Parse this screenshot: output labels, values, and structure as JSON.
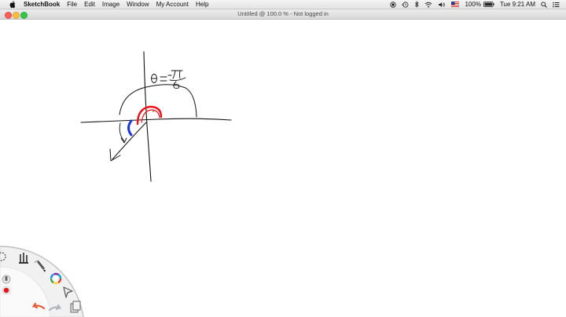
{
  "menubar": {
    "app_name": "SketchBook",
    "items": [
      "File",
      "Edit",
      "Image",
      "Window",
      "My Account",
      "Help"
    ],
    "battery": "100%",
    "clock": "Tue 9:21 AM"
  },
  "window": {
    "title": "Untitled @ 100.0 % - Not logged in"
  },
  "sketch": {
    "theta_label": "θ = -π/6",
    "colors": {
      "ink": "#111111",
      "arc_red": "#e8141b",
      "arc_blue": "#1b35d8"
    }
  },
  "toolbar": {
    "tools": [
      "settings-icon",
      "brush-library-icon",
      "pen-tool-icon",
      "color-wheel-icon",
      "layers-icon",
      "select-tool-icon",
      "undo-icon",
      "redo-icon",
      "clipboard-icon"
    ],
    "current_color": "#e8141b",
    "accent_colors": {
      "undo": "#e85a3a",
      "redo": "#9aa0a6"
    }
  }
}
